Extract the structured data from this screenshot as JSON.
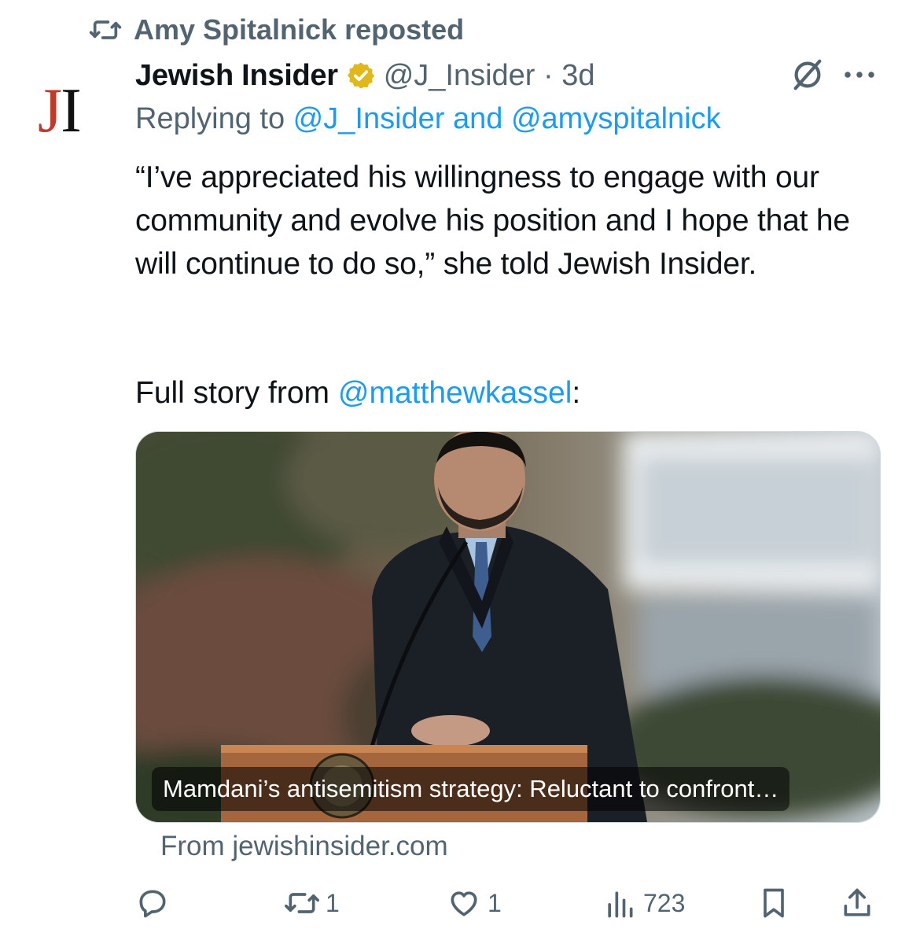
{
  "repost": {
    "label": "Amy Spitalnick reposted",
    "icon": "repost-icon"
  },
  "author": {
    "avatar_letters": {
      "first": "J",
      "second": "I"
    },
    "display_name": "Jewish Insider",
    "badge": "verified-gold-badge",
    "handle": "@J_Insider",
    "separator": " · ",
    "time": "3d"
  },
  "replying": {
    "prefix": "Replying to ",
    "mentions": "@J_Insider and @amyspitalnick"
  },
  "post": {
    "text": "“I’ve appreciated his willingness to engage with our community and evolve his position and I hope that he will continue to do so,” she told Jewish Insider.",
    "story_prefix": "Full story from ",
    "story_mention": "@matthewkassel",
    "story_suffix": ":"
  },
  "card": {
    "title": "Mamdani’s antisemitism strategy: Reluctant to confront…",
    "source": "From jewishinsider.com"
  },
  "actions": {
    "replies": "",
    "reposts": "1",
    "likes": "1",
    "views": "723"
  },
  "colors": {
    "accent": "#1d9bf0",
    "secondary_text": "#536471",
    "primary_text": "#0f1419",
    "badge_gold": "#e2b719",
    "logo_red": "#c0392b"
  }
}
